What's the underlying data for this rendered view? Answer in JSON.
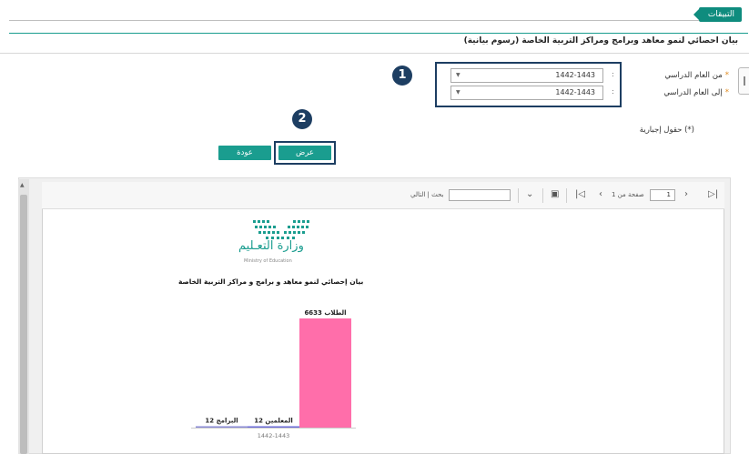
{
  "header": {
    "tab_label": "التبيقات"
  },
  "page": {
    "title": "بيان احصائي لنمو معاهد وبرامج ومراكز التربية الخاصة (رسوم بيانية)"
  },
  "form": {
    "from_year": {
      "label": "من العام الدراسي",
      "value": "1442-1443"
    },
    "to_year": {
      "label": "إلى العام الدراسي",
      "value": "1442-1443"
    },
    "required_note": "(*) حقول إجبارية"
  },
  "buttons": {
    "view": "عرض",
    "back": "عودة"
  },
  "callouts": {
    "one": "1",
    "two": "2"
  },
  "toolbar": {
    "page_number": "1",
    "page_of": "صفحة من 1",
    "search_text": "بحث | التالي"
  },
  "logo": {
    "arabic": "وزارة التعـليم",
    "english": "Ministry of Education"
  },
  "chart_data": {
    "type": "bar",
    "title": "بيان إحصائي لنمو معاهد و برامج و مراكز التربية الخاصة",
    "categories": [
      "1442-1443"
    ],
    "series": [
      {
        "name": "البرامج",
        "values": [
          12
        ],
        "color": "#8a8ad6"
      },
      {
        "name": "المعلمين",
        "values": [
          12
        ],
        "color": "#6b6bd8"
      },
      {
        "name": "الطلاب",
        "values": [
          6633
        ],
        "color": "#ff6eaa"
      }
    ],
    "data_labels": [
      "البرامج 12",
      "المعلمين 12",
      "الطلاب 6633"
    ],
    "xlabel": "",
    "ylabel": "",
    "ylim": [
      0,
      6633
    ]
  }
}
